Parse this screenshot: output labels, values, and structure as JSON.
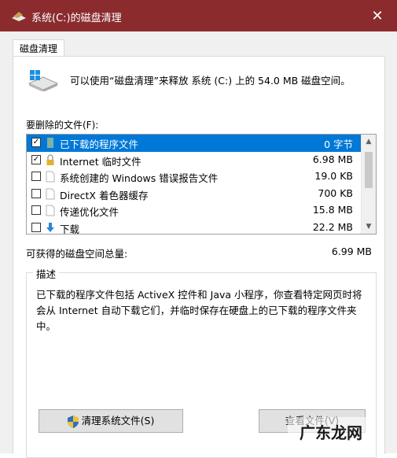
{
  "window": {
    "title": "系统(C:)的磁盘清理",
    "close_glyph": "✕"
  },
  "tabs": [
    {
      "label": "磁盘清理"
    }
  ],
  "summary": "可以使用“磁盘清理”来释放 系统 (C:) 上的 54.0 MB 磁盘空间。",
  "files_label": "要删除的文件(F):",
  "files": [
    {
      "name": "已下载的程序文件",
      "size": "0 字节",
      "checked": true,
      "selected": true,
      "icon": "folder-green-icon"
    },
    {
      "name": "Internet 临时文件",
      "size": "6.98 MB",
      "checked": true,
      "selected": false,
      "icon": "lock-icon"
    },
    {
      "name": "系统创建的 Windows 错误报告文件",
      "size": "19.0 KB",
      "checked": false,
      "selected": false,
      "icon": "document-icon"
    },
    {
      "name": "DirectX 着色器缓存",
      "size": "700 KB",
      "checked": false,
      "selected": false,
      "icon": "document-icon"
    },
    {
      "name": "传递优化文件",
      "size": "15.8 MB",
      "checked": false,
      "selected": false,
      "icon": "document-icon"
    },
    {
      "name": "下载",
      "size": "22.2 MB",
      "checked": false,
      "selected": false,
      "icon": "download-arrow-icon"
    }
  ],
  "total_label": "可获得的磁盘空间总量:",
  "total_value": "6.99 MB",
  "description_title": "描述",
  "description_text": "已下载的程序文件包括 ActiveX 控件和 Java 小程序，你查看特定网页时将会从 Internet 自动下载它们，并临时保存在硬盘上的已下载的程序文件夹中。",
  "buttons": {
    "clean_system": "清理系统文件(S)",
    "view_files": "查看文件(V)"
  },
  "watermark": "广东龙网",
  "colors": {
    "titlebar": "#8b2b2e",
    "selection": "#0078d7"
  }
}
